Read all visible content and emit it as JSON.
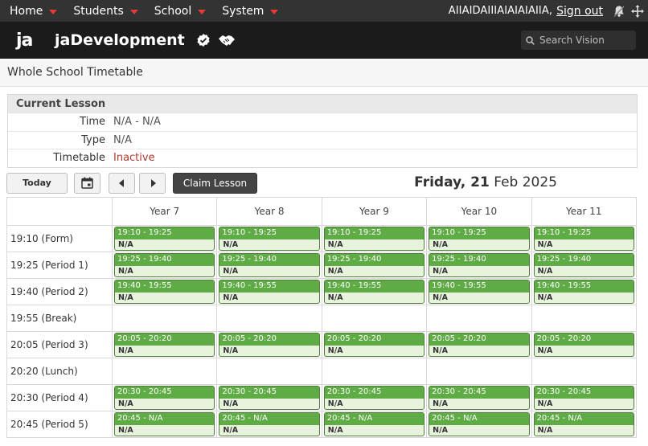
{
  "nav": {
    "items": [
      "Home",
      "Students",
      "School",
      "System"
    ],
    "user": "AIIAIDAIIIAIAIAIAIIA,",
    "signout": "Sign out"
  },
  "brand": {
    "logo": "ja",
    "title": "jaDevelopment",
    "search_placeholder": "Search Vision"
  },
  "page": {
    "title": "Whole School Timetable"
  },
  "current_lesson": {
    "heading": "Current Lesson",
    "rows": [
      {
        "label": "Time",
        "value": "N/A - N/A"
      },
      {
        "label": "Type",
        "value": "N/A"
      },
      {
        "label": "Timetable",
        "value": "Inactive"
      }
    ]
  },
  "toolbar": {
    "today": "Today",
    "claim": "Claim Lesson",
    "date_bold": "Friday, 21",
    "date_rest": " Feb 2025"
  },
  "timetable": {
    "years": [
      "Year 7",
      "Year 8",
      "Year 9",
      "Year 10",
      "Year 11"
    ],
    "periods": [
      {
        "label": "19:10 (Form)",
        "slot": "19:10 - 19:25",
        "detail": "N/A"
      },
      {
        "label": "19:25 (Period 1)",
        "slot": "19:25 - 19:40",
        "detail": "N/A"
      },
      {
        "label": "19:40 (Period 2)",
        "slot": "19:40 - 19:55",
        "detail": "N/A"
      },
      {
        "label": "19:55 (Break)",
        "slot": "",
        "detail": ""
      },
      {
        "label": "20:05 (Period 3)",
        "slot": "20:05 - 20:20",
        "detail": "N/A"
      },
      {
        "label": "20:20 (Lunch)",
        "slot": "",
        "detail": ""
      },
      {
        "label": "20:30 (Period 4)",
        "slot": "20:30 - 20:45",
        "detail": "N/A"
      },
      {
        "label": "20:45 (Period 5)",
        "slot": "20:45 - N/A",
        "detail": "N/A"
      }
    ]
  },
  "colors": {
    "accent_red": "#e53935",
    "slot_green": "#5fab45",
    "slot_bg": "#e8f3de"
  }
}
